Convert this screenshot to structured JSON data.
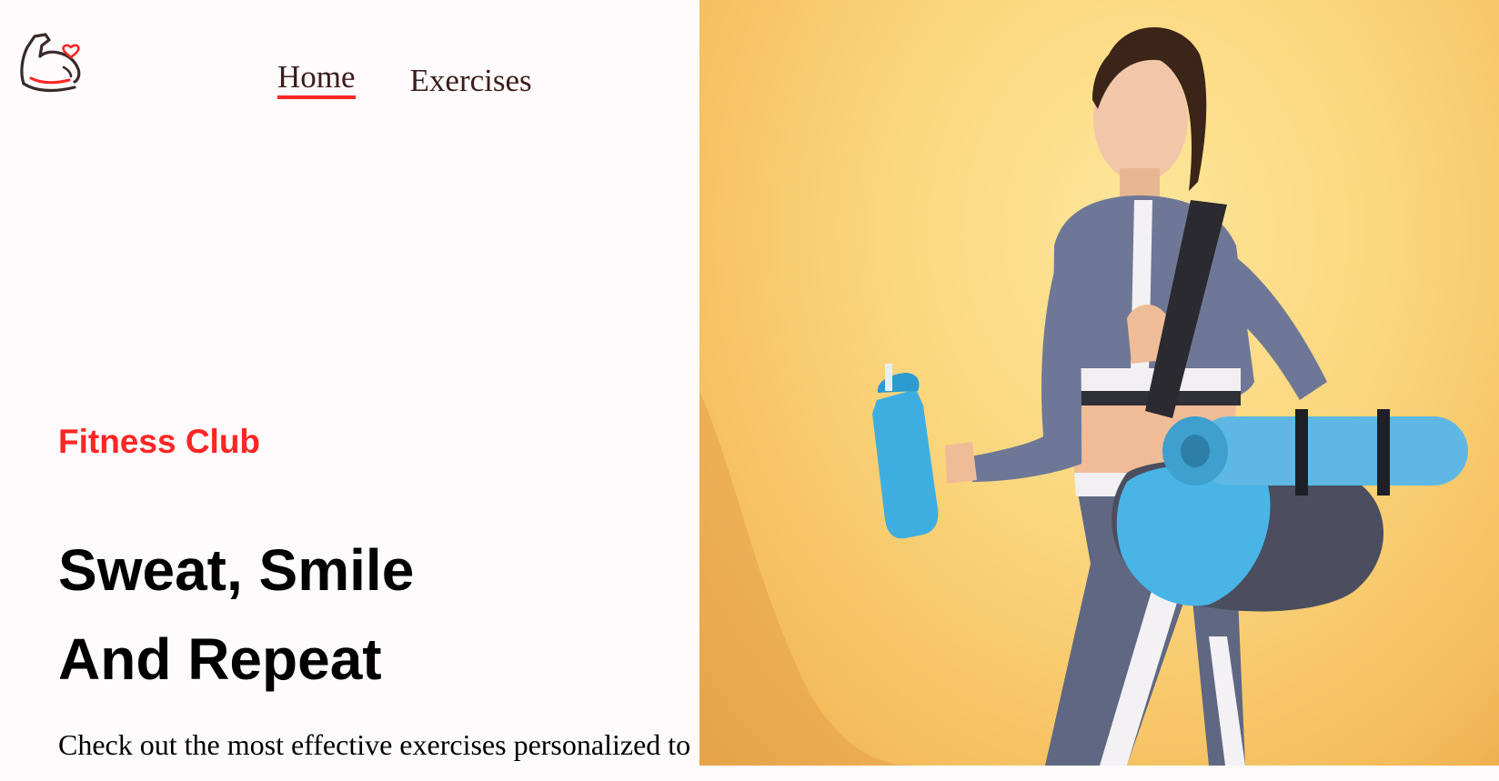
{
  "header": {
    "logo_icon": "flexed-arm-heart-icon",
    "nav": [
      {
        "label": "Home",
        "active": true
      },
      {
        "label": "Exercises",
        "active": false
      }
    ]
  },
  "hero": {
    "eyebrow": "Fitness Club",
    "title_line1": "Sweat, Smile",
    "title_line2": "And Repeat",
    "description": "Check out the most effective exercises personalized to"
  },
  "banner": {
    "image_icon": "woman-with-gym-bag-image"
  },
  "colors": {
    "accent": "#ff2625",
    "background": "#fffafb",
    "banner_yellow": "#fbd77e"
  }
}
